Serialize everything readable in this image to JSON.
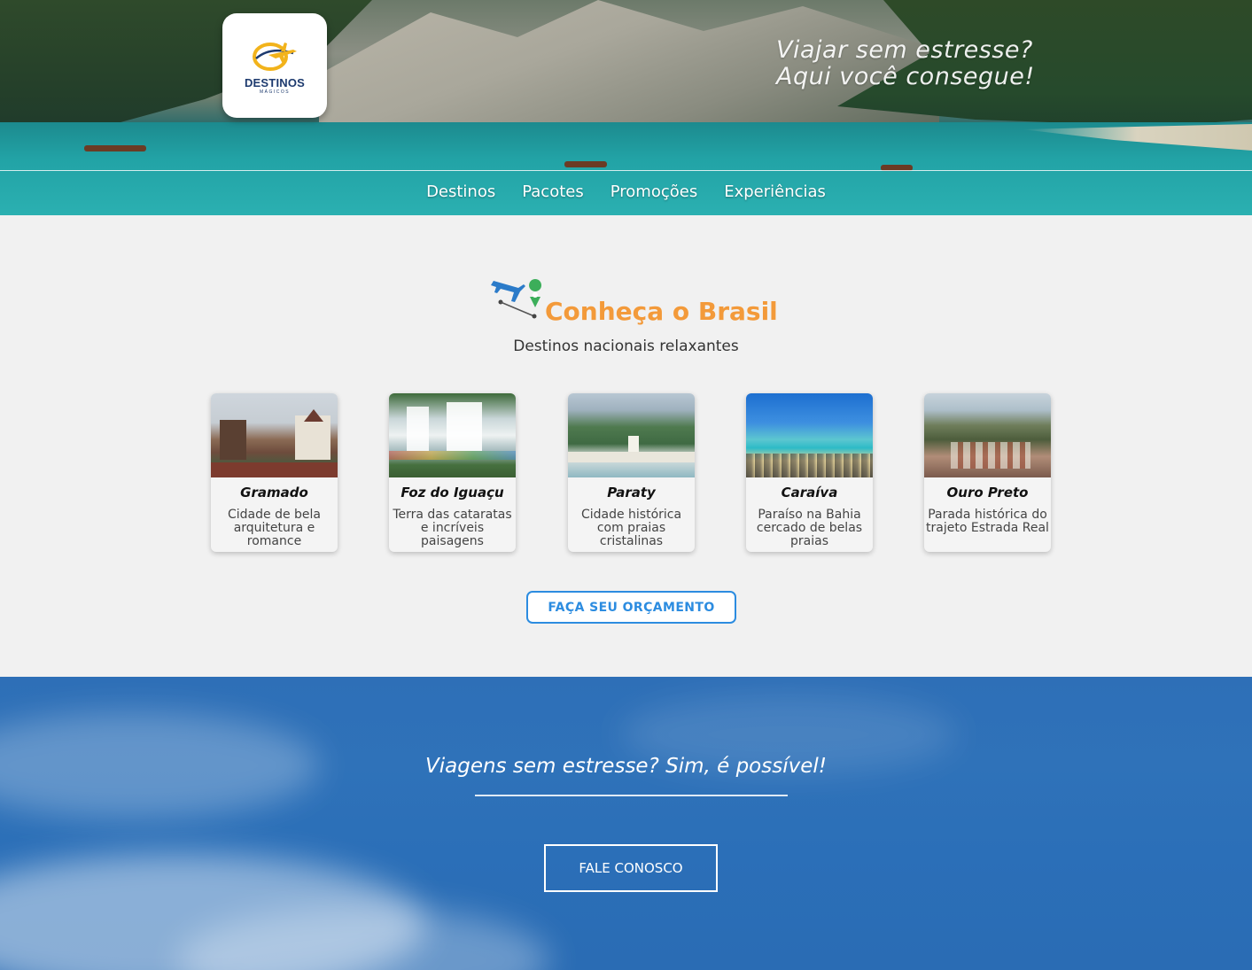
{
  "brand": {
    "name": "DESTINOS",
    "subtitle": "MÁGICOS"
  },
  "hero": {
    "tagline_line1": "Viajar sem estresse?",
    "tagline_line2": "Aqui você consegue!"
  },
  "nav": {
    "items": [
      {
        "label": "Destinos"
      },
      {
        "label": "Pacotes"
      },
      {
        "label": "Promoções"
      },
      {
        "label": "Experiências"
      }
    ]
  },
  "destinations": {
    "title": "Conheça o Brasil",
    "subtitle": "Destinos nacionais relaxantes",
    "cards": [
      {
        "title": "Gramado",
        "description": "Cidade de bela arquitetura e romance"
      },
      {
        "title": "Foz do Iguaçu",
        "description": "Terra das cataratas e incríveis paisagens"
      },
      {
        "title": "Paraty",
        "description": "Cidade histórica com praias cristalinas"
      },
      {
        "title": "Caraíva",
        "description": "Paraíso na Bahia cercado de belas praias"
      },
      {
        "title": "Ouro Preto",
        "description": "Parada histórica do trajeto Estrada Real"
      }
    ],
    "cta_label": "FAÇA SEU ORÇAMENTO"
  },
  "contact": {
    "headline": "Viagens sem estresse? Sim, é possível!",
    "cta_label": "FALE CONOSCO"
  },
  "colors": {
    "accent_orange": "#f39a3a",
    "accent_blue": "#2c8ce0",
    "sky_blue": "#2e6fb7"
  }
}
